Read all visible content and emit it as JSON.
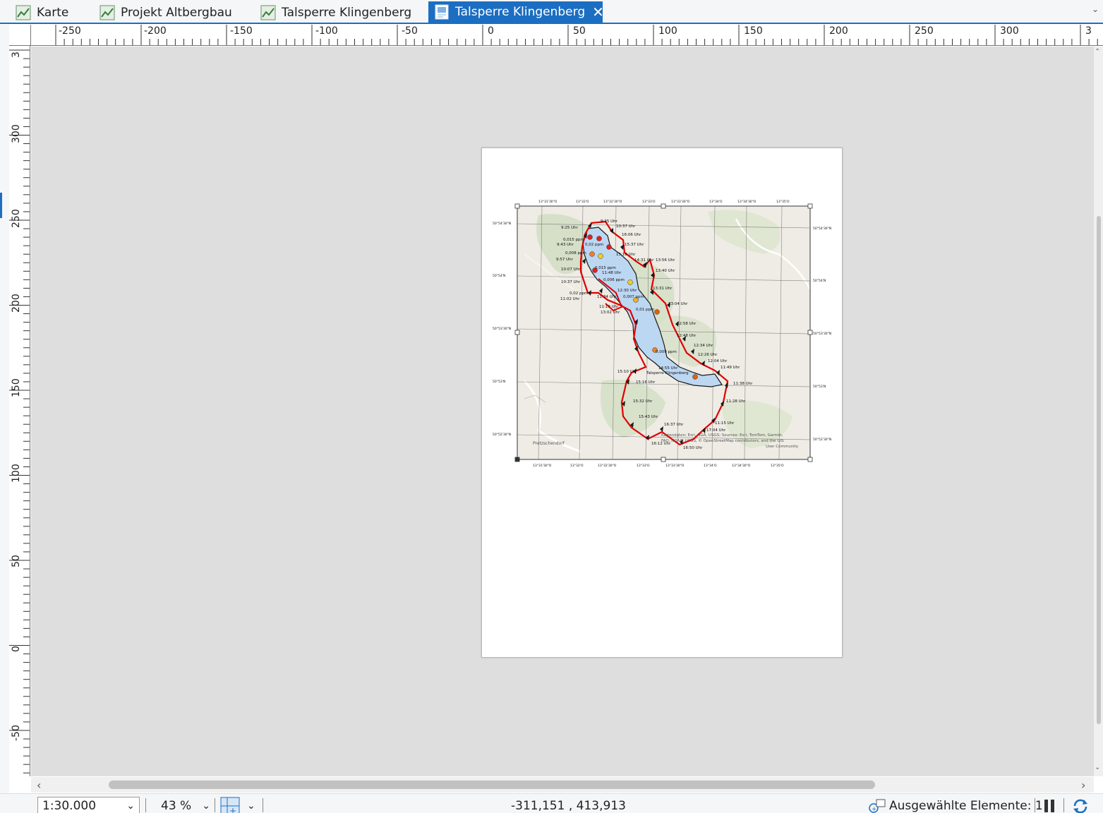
{
  "tabs": [
    {
      "label": "Karte",
      "icon": "map-icon"
    },
    {
      "label": "Projekt Altbergbau",
      "icon": "map-icon"
    },
    {
      "label": "Talsperre Klingenberg",
      "icon": "map-icon"
    },
    {
      "label": "Talsperre Klingenberg",
      "icon": "layout-icon",
      "active": true,
      "close_glyph": "✕"
    }
  ],
  "ruler": {
    "horizontal": [
      "-250",
      "-200",
      "-150",
      "-100",
      "-50",
      "0",
      "50",
      "100",
      "150",
      "200",
      "250",
      "300",
      "3"
    ],
    "vertical": [
      "3",
      "300",
      "250",
      "200",
      "150",
      "100",
      "50",
      "0",
      "-50"
    ]
  },
  "map": {
    "lat_labels_left": [
      "50°54'30\"N",
      "50°54'N",
      "50°53'30\"N",
      "50°53'N",
      "50°52'30\"N"
    ],
    "lon_labels_top": [
      "13°31'30\"O",
      "13°32'O",
      "13°32'30\"O",
      "13°33'O",
      "13°33'30\"O",
      "13°34'O",
      "13°34'30\"O",
      "13°35'O"
    ],
    "reservoir_label": "Talsperre Klingenberg",
    "time_labels": [
      "9:25 Uhr",
      "9:35 Uhr",
      "10:37 Uhr",
      "16:06 Uhr",
      "15:37 Uhr",
      "15:16 Uhr",
      "9:43 Uhr",
      "9:57 Uhr",
      "10:07 Uhr",
      "14:31 Uhr",
      "13:56 Uhr",
      "13:40 Uhr",
      "11:48 Uhr",
      "10:37 Uhr",
      "11:02 Uhr",
      "11:34 Uhr",
      "11:19 Uhr",
      "13:02 Uhr",
      "12:30 Uhr",
      "13:31 Uhr",
      "13:04 Uhr",
      "12:58 Uhr",
      "12:48 Uhr",
      "12:34 Uhr",
      "12:26 Uhr",
      "12:04 Uhr",
      "11:49 Uhr",
      "11:38 Uhr",
      "15:10 Uhr",
      "15:16 Uhr",
      "14:55 Uhr",
      "15:32 Uhr",
      "15:43 Uhr",
      "16:37 Uhr",
      "16:12 Uhr",
      "16:50 Uhr",
      "11:28 Uhr",
      "11:15 Uhr",
      "17:04 Uhr"
    ],
    "ppm_labels": [
      "0,015 ppm",
      "0,02 ppm",
      "0,008 ppm",
      "0,015 ppm",
      "0,006 ppm",
      "0,02 ppm",
      "0,007 ppm",
      "0,01 ppm",
      "0,009 ppm"
    ],
    "place_labels": [
      "Pretzschendorf"
    ],
    "attribution": "Kartendaten: Esri, NGA, USGS; Sources: Esri, TomTom, Garmin, FAO, NOAA, USGS, © OpenStreetMap contributors, and the GIS User Community"
  },
  "status": {
    "scale": "1:30.000",
    "zoom": "43 %",
    "coordinates": "-311,151 , 413,913",
    "selected": "Ausgewählte Elemente: 1"
  }
}
